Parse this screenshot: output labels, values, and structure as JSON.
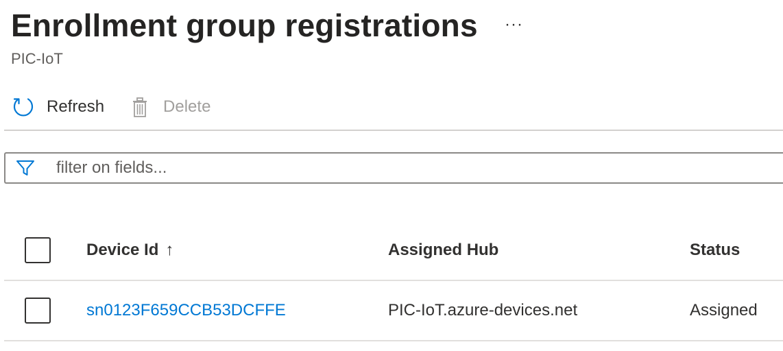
{
  "header": {
    "title": "Enrollment group registrations",
    "more_label": "···",
    "subtitle": "PIC-IoT"
  },
  "toolbar": {
    "refresh_label": "Refresh",
    "refresh_icon": "refresh-icon",
    "delete_label": "Delete",
    "delete_icon": "trash-icon"
  },
  "filter": {
    "placeholder": "filter on fields...",
    "value": "",
    "icon": "filter-icon"
  },
  "table": {
    "columns": [
      "Device Id",
      "Assigned Hub",
      "Status"
    ],
    "sort_indicator": "↑",
    "rows": [
      {
        "device_id": "sn0123F659CCB53DCFFE",
        "assigned_hub": "PIC-IoT.azure-devices.net",
        "status": "Assigned"
      }
    ]
  },
  "colors": {
    "accent": "#0078d4",
    "text": "#323130",
    "disabled": "#a19f9d"
  }
}
